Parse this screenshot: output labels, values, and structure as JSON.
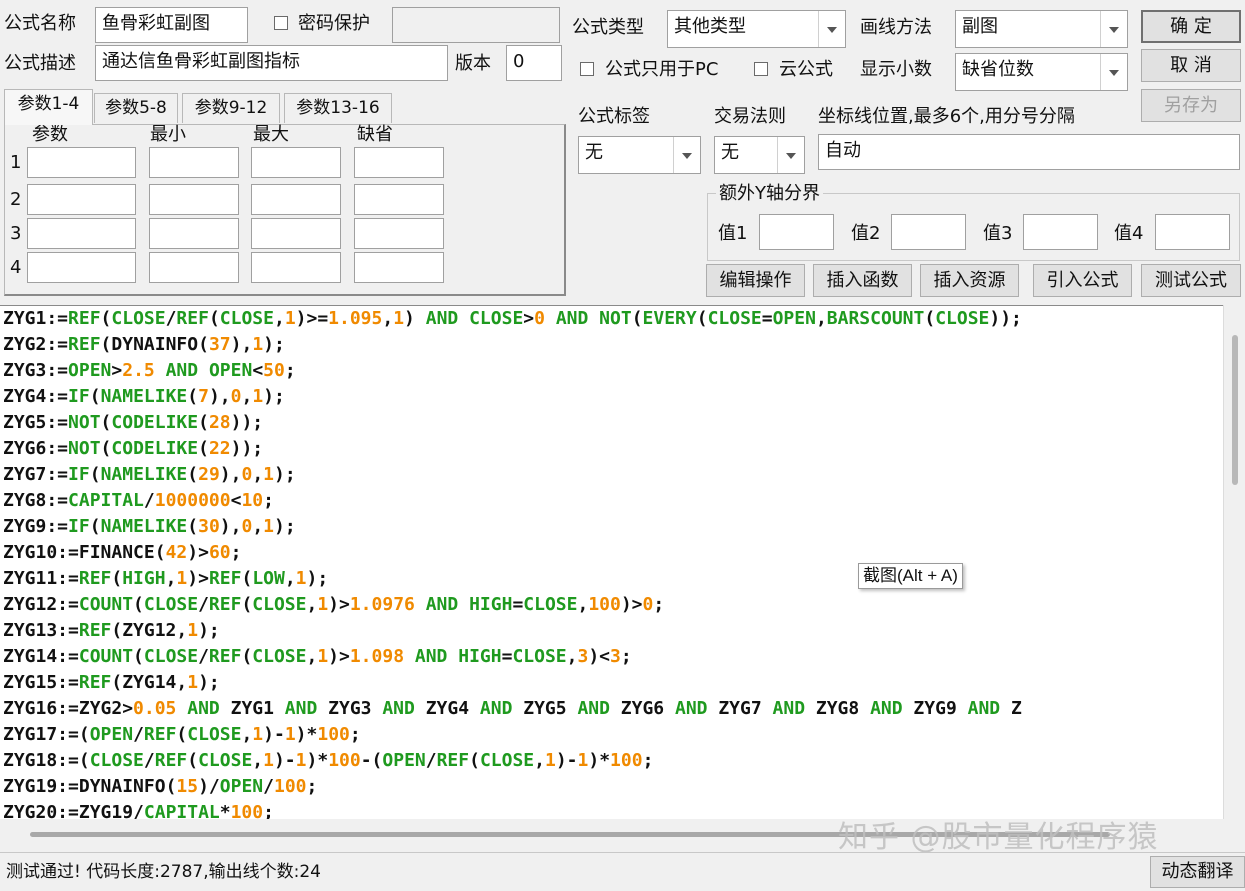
{
  "header": {
    "name_label": "公式名称",
    "name_value": "鱼骨彩虹副图",
    "password_label": "密码保护",
    "desc_label": "公式描述",
    "desc_value": "通达信鱼骨彩虹副图指标",
    "version_label": "版本",
    "version_value": "0",
    "type_label": "公式类型",
    "type_value": "其他类型",
    "draw_label": "画线方法",
    "draw_value": "副图",
    "pc_only_label": "公式只用于PC",
    "cloud_label": "云公式",
    "decimals_label": "显示小数",
    "decimals_value": "缺省位数"
  },
  "buttons": {
    "ok": "确 定",
    "cancel": "取 消",
    "save_as": "另存为",
    "edit_ops": "编辑操作",
    "insert_func": "插入函数",
    "insert_res": "插入资源",
    "import_formula": "引入公式",
    "test_formula": "测试公式",
    "dynamic_translate": "动态翻译"
  },
  "params": {
    "tabs": [
      "参数1-4",
      "参数5-8",
      "参数9-12",
      "参数13-16"
    ],
    "headers": [
      "参数",
      "最小",
      "最大",
      "缺省"
    ],
    "rows": [
      "1",
      "2",
      "3",
      "4"
    ]
  },
  "right": {
    "tag_label": "公式标签",
    "tag_value": "无",
    "rule_label": "交易法则",
    "rule_value": "无",
    "axis_label": "坐标线位置,最多6个,用分号分隔",
    "axis_value": "自动",
    "extra_y_label": "额外Y轴分界",
    "value_labels": [
      "值1",
      "值2",
      "值3",
      "值4"
    ]
  },
  "editor": {
    "lines": [
      [
        [
          "ZYG1:=",
          "i"
        ],
        [
          "REF",
          "f"
        ],
        [
          "(",
          "o"
        ],
        [
          "CLOSE",
          "f"
        ],
        [
          "/",
          "o"
        ],
        [
          "REF",
          "f"
        ],
        [
          "(",
          "o"
        ],
        [
          "CLOSE",
          "f"
        ],
        [
          ",",
          "o"
        ],
        [
          "1",
          "n"
        ],
        [
          ")>=",
          "o"
        ],
        [
          "1.095",
          "n"
        ],
        [
          ",",
          "o"
        ],
        [
          "1",
          "n"
        ],
        [
          ") ",
          "o"
        ],
        [
          "AND",
          "f"
        ],
        [
          " ",
          "o"
        ],
        [
          "CLOSE",
          "f"
        ],
        [
          ">",
          "o"
        ],
        [
          "0",
          "n"
        ],
        [
          " ",
          "o"
        ],
        [
          "AND",
          "f"
        ],
        [
          " ",
          "o"
        ],
        [
          "NOT",
          "f"
        ],
        [
          "(",
          "o"
        ],
        [
          "EVERY",
          "f"
        ],
        [
          "(",
          "o"
        ],
        [
          "CLOSE",
          "f"
        ],
        [
          "=",
          "o"
        ],
        [
          "OPEN",
          "f"
        ],
        [
          ",",
          "o"
        ],
        [
          "BARSCOUNT",
          "f"
        ],
        [
          "(",
          "o"
        ],
        [
          "CLOSE",
          "f"
        ],
        [
          "));",
          "o"
        ]
      ],
      [
        [
          "ZYG2:=",
          "i"
        ],
        [
          "REF",
          "f"
        ],
        [
          "(",
          "o"
        ],
        [
          "DYNAINFO",
          "i"
        ],
        [
          "(",
          "o"
        ],
        [
          "37",
          "n"
        ],
        [
          "),",
          "o"
        ],
        [
          "1",
          "n"
        ],
        [
          ");",
          "o"
        ]
      ],
      [
        [
          "ZYG3:=",
          "i"
        ],
        [
          "OPEN",
          "f"
        ],
        [
          ">",
          "o"
        ],
        [
          "2.5",
          "n"
        ],
        [
          " ",
          "o"
        ],
        [
          "AND",
          "f"
        ],
        [
          " ",
          "o"
        ],
        [
          "OPEN",
          "f"
        ],
        [
          "<",
          "o"
        ],
        [
          "50",
          "n"
        ],
        [
          ";",
          "o"
        ]
      ],
      [
        [
          "ZYG4:=",
          "i"
        ],
        [
          "IF",
          "f"
        ],
        [
          "(",
          "o"
        ],
        [
          "NAMELIKE",
          "f"
        ],
        [
          "(",
          "o"
        ],
        [
          "7",
          "n"
        ],
        [
          "),",
          "o"
        ],
        [
          "0",
          "n"
        ],
        [
          ",",
          "o"
        ],
        [
          "1",
          "n"
        ],
        [
          ");",
          "o"
        ]
      ],
      [
        [
          "ZYG5:=",
          "i"
        ],
        [
          "NOT",
          "f"
        ],
        [
          "(",
          "o"
        ],
        [
          "CODELIKE",
          "f"
        ],
        [
          "(",
          "o"
        ],
        [
          "28",
          "n"
        ],
        [
          "));",
          "o"
        ]
      ],
      [
        [
          "ZYG6:=",
          "i"
        ],
        [
          "NOT",
          "f"
        ],
        [
          "(",
          "o"
        ],
        [
          "CODELIKE",
          "f"
        ],
        [
          "(",
          "o"
        ],
        [
          "22",
          "n"
        ],
        [
          "));",
          "o"
        ]
      ],
      [
        [
          "ZYG7:=",
          "i"
        ],
        [
          "IF",
          "f"
        ],
        [
          "(",
          "o"
        ],
        [
          "NAMELIKE",
          "f"
        ],
        [
          "(",
          "o"
        ],
        [
          "29",
          "n"
        ],
        [
          "),",
          "o"
        ],
        [
          "0",
          "n"
        ],
        [
          ",",
          "o"
        ],
        [
          "1",
          "n"
        ],
        [
          ");",
          "o"
        ]
      ],
      [
        [
          "ZYG8:=",
          "i"
        ],
        [
          "CAPITAL",
          "f"
        ],
        [
          "/",
          "o"
        ],
        [
          "1000000",
          "n"
        ],
        [
          "<",
          "o"
        ],
        [
          "10",
          "n"
        ],
        [
          ";",
          "o"
        ]
      ],
      [
        [
          "ZYG9:=",
          "i"
        ],
        [
          "IF",
          "f"
        ],
        [
          "(",
          "o"
        ],
        [
          "NAMELIKE",
          "f"
        ],
        [
          "(",
          "o"
        ],
        [
          "30",
          "n"
        ],
        [
          "),",
          "o"
        ],
        [
          "0",
          "n"
        ],
        [
          ",",
          "o"
        ],
        [
          "1",
          "n"
        ],
        [
          ");",
          "o"
        ]
      ],
      [
        [
          "ZYG10:=",
          "i"
        ],
        [
          "FINANCE",
          "i"
        ],
        [
          "(",
          "o"
        ],
        [
          "42",
          "n"
        ],
        [
          ")>",
          "o"
        ],
        [
          "60",
          "n"
        ],
        [
          ";",
          "o"
        ]
      ],
      [
        [
          "ZYG11:=",
          "i"
        ],
        [
          "REF",
          "f"
        ],
        [
          "(",
          "o"
        ],
        [
          "HIGH",
          "f"
        ],
        [
          ",",
          "o"
        ],
        [
          "1",
          "n"
        ],
        [
          ")>",
          "o"
        ],
        [
          "REF",
          "f"
        ],
        [
          "(",
          "o"
        ],
        [
          "LOW",
          "f"
        ],
        [
          ",",
          "o"
        ],
        [
          "1",
          "n"
        ],
        [
          ");",
          "o"
        ]
      ],
      [
        [
          "ZYG12:=",
          "i"
        ],
        [
          "COUNT",
          "f"
        ],
        [
          "(",
          "o"
        ],
        [
          "CLOSE",
          "f"
        ],
        [
          "/",
          "o"
        ],
        [
          "REF",
          "f"
        ],
        [
          "(",
          "o"
        ],
        [
          "CLOSE",
          "f"
        ],
        [
          ",",
          "o"
        ],
        [
          "1",
          "n"
        ],
        [
          ")>",
          "o"
        ],
        [
          "1.0976",
          "n"
        ],
        [
          " ",
          "o"
        ],
        [
          "AND",
          "f"
        ],
        [
          " ",
          "o"
        ],
        [
          "HIGH",
          "f"
        ],
        [
          "=",
          "o"
        ],
        [
          "CLOSE",
          "f"
        ],
        [
          ",",
          "o"
        ],
        [
          "100",
          "n"
        ],
        [
          ")>",
          "o"
        ],
        [
          "0",
          "n"
        ],
        [
          ";",
          "o"
        ]
      ],
      [
        [
          "ZYG13:=",
          "i"
        ],
        [
          "REF",
          "f"
        ],
        [
          "(ZYG12,",
          "o"
        ],
        [
          "1",
          "n"
        ],
        [
          ");",
          "o"
        ]
      ],
      [
        [
          "ZYG14:=",
          "i"
        ],
        [
          "COUNT",
          "f"
        ],
        [
          "(",
          "o"
        ],
        [
          "CLOSE",
          "f"
        ],
        [
          "/",
          "o"
        ],
        [
          "REF",
          "f"
        ],
        [
          "(",
          "o"
        ],
        [
          "CLOSE",
          "f"
        ],
        [
          ",",
          "o"
        ],
        [
          "1",
          "n"
        ],
        [
          ")>",
          "o"
        ],
        [
          "1.098",
          "n"
        ],
        [
          " ",
          "o"
        ],
        [
          "AND",
          "f"
        ],
        [
          " ",
          "o"
        ],
        [
          "HIGH",
          "f"
        ],
        [
          "=",
          "o"
        ],
        [
          "CLOSE",
          "f"
        ],
        [
          ",",
          "o"
        ],
        [
          "3",
          "n"
        ],
        [
          ")<",
          "o"
        ],
        [
          "3",
          "n"
        ],
        [
          ";",
          "o"
        ]
      ],
      [
        [
          "ZYG15:=",
          "i"
        ],
        [
          "REF",
          "f"
        ],
        [
          "(ZYG14,",
          "o"
        ],
        [
          "1",
          "n"
        ],
        [
          ");",
          "o"
        ]
      ],
      [
        [
          "ZYG16:=ZYG2>",
          "i"
        ],
        [
          "0.05",
          "n"
        ],
        [
          " ",
          "o"
        ],
        [
          "AND",
          "f"
        ],
        [
          " ZYG1 ",
          "o"
        ],
        [
          "AND",
          "f"
        ],
        [
          " ZYG3 ",
          "o"
        ],
        [
          "AND",
          "f"
        ],
        [
          " ZYG4 ",
          "o"
        ],
        [
          "AND",
          "f"
        ],
        [
          " ZYG5 ",
          "o"
        ],
        [
          "AND",
          "f"
        ],
        [
          " ZYG6 ",
          "o"
        ],
        [
          "AND",
          "f"
        ],
        [
          " ZYG7 ",
          "o"
        ],
        [
          "AND",
          "f"
        ],
        [
          " ZYG8 ",
          "o"
        ],
        [
          "AND",
          "f"
        ],
        [
          " ZYG9 ",
          "o"
        ],
        [
          "AND",
          "f"
        ],
        [
          " Z",
          "o"
        ]
      ],
      [
        [
          "ZYG17:=(",
          "i"
        ],
        [
          "OPEN",
          "f"
        ],
        [
          "/",
          "o"
        ],
        [
          "REF",
          "f"
        ],
        [
          "(",
          "o"
        ],
        [
          "CLOSE",
          "f"
        ],
        [
          ",",
          "o"
        ],
        [
          "1",
          "n"
        ],
        [
          ")-",
          "o"
        ],
        [
          "1",
          "n"
        ],
        [
          ")*",
          "o"
        ],
        [
          "100",
          "n"
        ],
        [
          ";",
          "o"
        ]
      ],
      [
        [
          "ZYG18:=(",
          "i"
        ],
        [
          "CLOSE",
          "f"
        ],
        [
          "/",
          "o"
        ],
        [
          "REF",
          "f"
        ],
        [
          "(",
          "o"
        ],
        [
          "CLOSE",
          "f"
        ],
        [
          ",",
          "o"
        ],
        [
          "1",
          "n"
        ],
        [
          ")-",
          "o"
        ],
        [
          "1",
          "n"
        ],
        [
          ")*",
          "o"
        ],
        [
          "100",
          "n"
        ],
        [
          "-(",
          "o"
        ],
        [
          "OPEN",
          "f"
        ],
        [
          "/",
          "o"
        ],
        [
          "REF",
          "f"
        ],
        [
          "(",
          "o"
        ],
        [
          "CLOSE",
          "f"
        ],
        [
          ",",
          "o"
        ],
        [
          "1",
          "n"
        ],
        [
          ")-",
          "o"
        ],
        [
          "1",
          "n"
        ],
        [
          ")*",
          "o"
        ],
        [
          "100",
          "n"
        ],
        [
          ";",
          "o"
        ]
      ],
      [
        [
          "ZYG19:=",
          "i"
        ],
        [
          "DYNAINFO",
          "i"
        ],
        [
          "(",
          "o"
        ],
        [
          "15",
          "n"
        ],
        [
          ")/",
          "o"
        ],
        [
          "OPEN",
          "f"
        ],
        [
          "/",
          "o"
        ],
        [
          "100",
          "n"
        ],
        [
          ";",
          "o"
        ]
      ],
      [
        [
          "ZYG20:=ZYG19/",
          "i"
        ],
        [
          "CAPITAL",
          "f"
        ],
        [
          "*",
          "o"
        ],
        [
          "100",
          "n"
        ],
        [
          ";",
          "o"
        ]
      ]
    ]
  },
  "tooltip": "截图(Alt + A)",
  "watermark": "知乎 @股市量化程序猿",
  "status": "测试通过! 代码长度:2787,输出线个数:24",
  "colors": {
    "function": "#1f9a1f",
    "number": "#f08a00",
    "text": "#111111"
  }
}
